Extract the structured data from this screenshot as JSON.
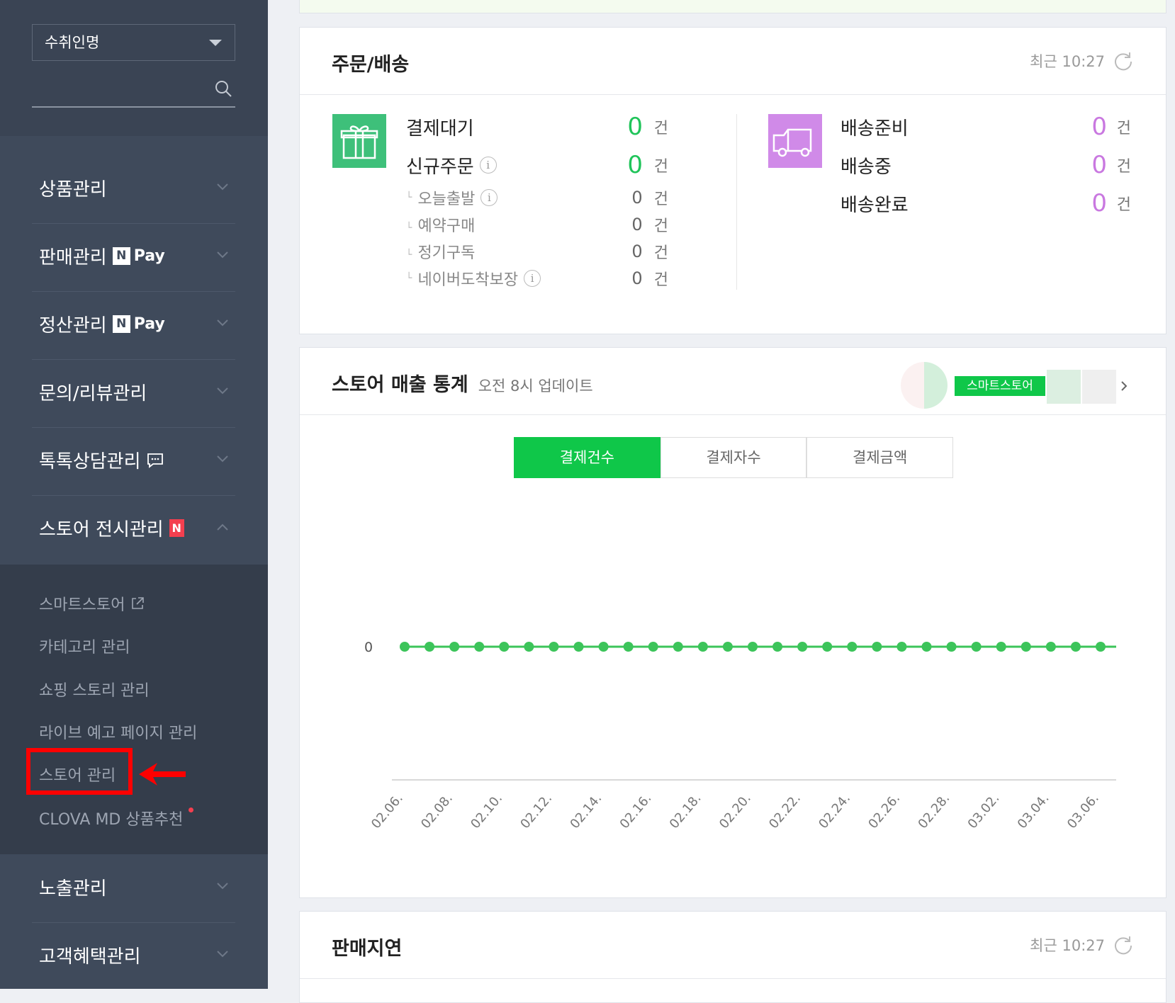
{
  "sidebar": {
    "select_value": "수취인명",
    "search_placeholder": "",
    "menu": [
      {
        "label": "상품관리"
      },
      {
        "label": "판매관리",
        "badge": "Pay"
      },
      {
        "label": "정산관리",
        "badge": "Pay"
      },
      {
        "label": "문의/리뷰관리"
      },
      {
        "label": "톡톡상담관리"
      },
      {
        "label": "스토어 전시관리",
        "badge": "N"
      },
      {
        "label": "노출관리"
      },
      {
        "label": "고객혜택관리"
      }
    ],
    "npay_n": "N",
    "submenu": [
      "스마트스토어",
      "카테고리 관리",
      "쇼핑 스토리 관리",
      "라이브 예고 페이지 관리",
      "스토어 관리",
      "CLOVA MD 상품추천"
    ]
  },
  "orders": {
    "title": "주문/배송",
    "updated": "최근 10:27",
    "unit": "건",
    "left": [
      {
        "label": "결제대기",
        "value": "0"
      },
      {
        "label": "신규주문",
        "value": "0",
        "info": true
      },
      {
        "label": "오늘출발",
        "value": "0",
        "info": true
      },
      {
        "label": "예약구매",
        "value": "0"
      },
      {
        "label": "정기구독",
        "value": "0"
      },
      {
        "label": "네이버도착보장",
        "value": "0",
        "info": true
      }
    ],
    "right": [
      {
        "label": "배송준비",
        "value": "0"
      },
      {
        "label": "배송중",
        "value": "0"
      },
      {
        "label": "배송완료",
        "value": "0"
      }
    ]
  },
  "stats": {
    "title": "스토어 매출 통계",
    "subtitle": "오전 8시 업데이트",
    "store_tag": "스마트스토어",
    "tabs": [
      "결제건수",
      "결제자수",
      "결제금액"
    ],
    "active_tab": 0
  },
  "delay": {
    "title": "판매지연",
    "updated": "최근 10:27"
  },
  "colors": {
    "green": "#0fc749",
    "purple": "#c978e0",
    "sidebar": "#3f4a5b",
    "highlight": "#ff0000"
  },
  "chart_data": {
    "type": "line",
    "x": [
      "02.06.",
      "02.07.",
      "02.08.",
      "02.09.",
      "02.10.",
      "02.11.",
      "02.12.",
      "02.13.",
      "02.14.",
      "02.15.",
      "02.16.",
      "02.17.",
      "02.18.",
      "02.19.",
      "02.20.",
      "02.21.",
      "02.22.",
      "02.23.",
      "02.24.",
      "02.25.",
      "02.26.",
      "02.27.",
      "02.28.",
      "03.01.",
      "03.02.",
      "03.03.",
      "03.04.",
      "03.05.",
      "03.06."
    ],
    "x_tick_labels": [
      "02.06.",
      "02.08.",
      "02.10.",
      "02.12.",
      "02.14.",
      "02.16.",
      "02.18.",
      "02.20.",
      "02.22.",
      "02.24.",
      "02.26.",
      "02.28.",
      "03.02.",
      "03.04.",
      "03.06."
    ],
    "series": [
      {
        "values": [
          0,
          0,
          0,
          0,
          0,
          0,
          0,
          0,
          0,
          0,
          0,
          0,
          0,
          0,
          0,
          0,
          0,
          0,
          0,
          0,
          0,
          0,
          0,
          0,
          0,
          0,
          0,
          0,
          0
        ]
      }
    ],
    "y_tick_labels": [
      "0"
    ],
    "color": "#3cc45a"
  }
}
